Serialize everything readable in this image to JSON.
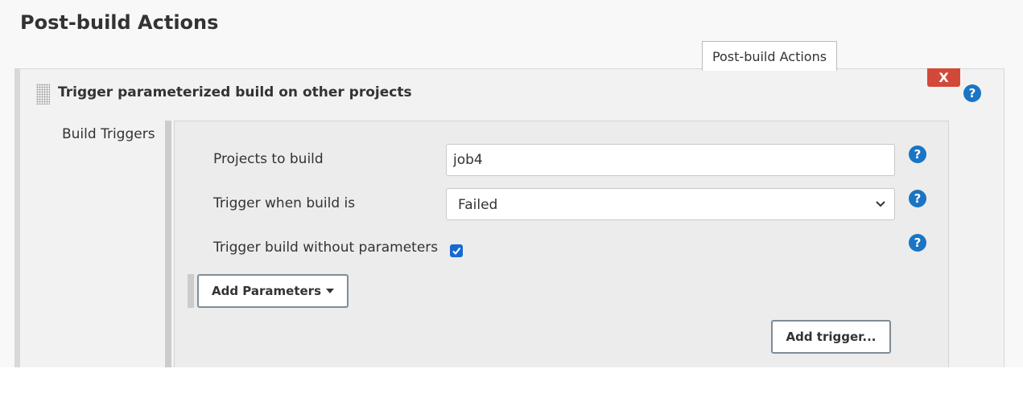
{
  "section": {
    "title": "Post-build Actions"
  },
  "tab": {
    "label": "Post-build Actions"
  },
  "step": {
    "title": "Trigger parameterized build on other projects",
    "delete_label": "X"
  },
  "build_triggers": {
    "label": "Build Triggers",
    "projects_label": "Projects to build",
    "projects_value": "job4",
    "trigger_when_label": "Trigger when build is",
    "trigger_when_value": "Failed",
    "without_params_label": "Trigger build without parameters",
    "without_params_checked": true,
    "add_parameters_label": "Add Parameters",
    "add_trigger_label": "Add trigger..."
  },
  "colors": {
    "delete": "#d24939",
    "help": "#1a75c4",
    "checkbox": "#1669d3"
  },
  "icons": [
    "drag-handle-icon",
    "help-icon",
    "chevron-down-icon",
    "check-icon",
    "caret-down-icon"
  ]
}
